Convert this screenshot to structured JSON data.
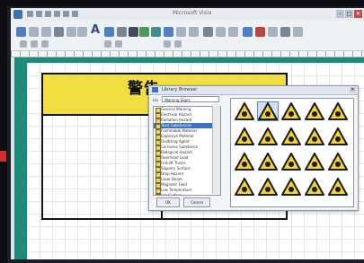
{
  "window": {
    "title": "Microsoft Visio",
    "min_label": "–",
    "max_label": "□",
    "close_label": "✕"
  },
  "toolbar": {
    "font_icon_label": "A"
  },
  "sign": {
    "header_text": "警告"
  },
  "dialog": {
    "title": "Library Browser",
    "close_label": "✕",
    "category_label": "Lib",
    "category_value": "Warning Signs",
    "items": [
      "General Warning",
      "Electrical Hazard",
      "Radiation Hazard",
      "Toxic Substances",
      "Flammable Material",
      "Explosive Material",
      "Oxidizing Agent",
      "Corrosive Substance",
      "Biological Hazard",
      "Overhead Load",
      "Forklift Trucks",
      "Slippery Surface",
      "Drop Hazard",
      "Laser Beam",
      "Magnetic Field",
      "Low Temperature",
      "Hot Surface",
      "Noise Hazard"
    ],
    "selected_index": 3,
    "ok_label": "OK",
    "cancel_label": "Cancel",
    "grid_symbols": [
      [
        "general",
        "electric",
        "radiation",
        "toxic",
        "biohazard"
      ],
      [
        "flammable",
        "explosive",
        "oxidizer",
        "corrosive",
        "laser"
      ],
      [
        "overhead",
        "forklift",
        "slippery",
        "magnetic",
        "hot"
      ],
      [
        "drop",
        "noise",
        "low-temp",
        "crush",
        "trip"
      ]
    ],
    "selected_symbol": "electric"
  }
}
